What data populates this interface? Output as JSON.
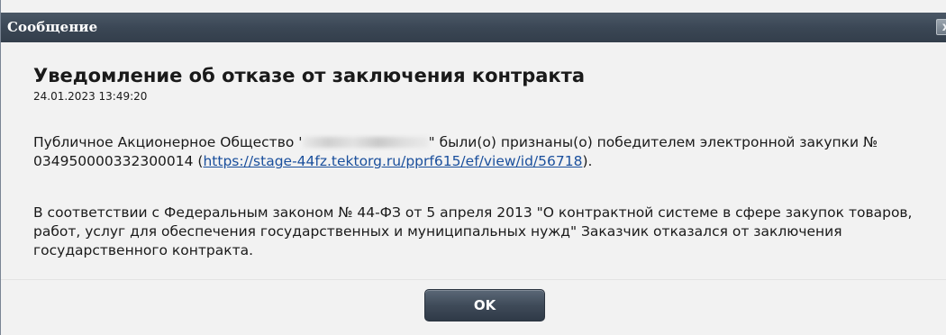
{
  "dialog": {
    "title": "Сообщение",
    "close_label": "x",
    "heading": "Уведомление об отказе от заключения контракта",
    "date": "24.01.2023 13:49:20",
    "para1": {
      "prefix": "Публичное Акционерное Общество '",
      "suffix": "\" были(о) признаны(о) победителем электронной закупки № 034950000332300014 (",
      "link": "https://stage-44fz.tektorg.ru/pprf615/ef/view/id/56718",
      "end": ")."
    },
    "para2": "В соответствии с Федеральным законом № 44-ФЗ от 5 апреля 2013 \"О контрактной системе в сфере закупок товаров, работ, услуг для обеспечения государственных и муниципальных нужд\" Заказчик отказался от заключения государственного контракта.",
    "ok_label": "OK"
  }
}
